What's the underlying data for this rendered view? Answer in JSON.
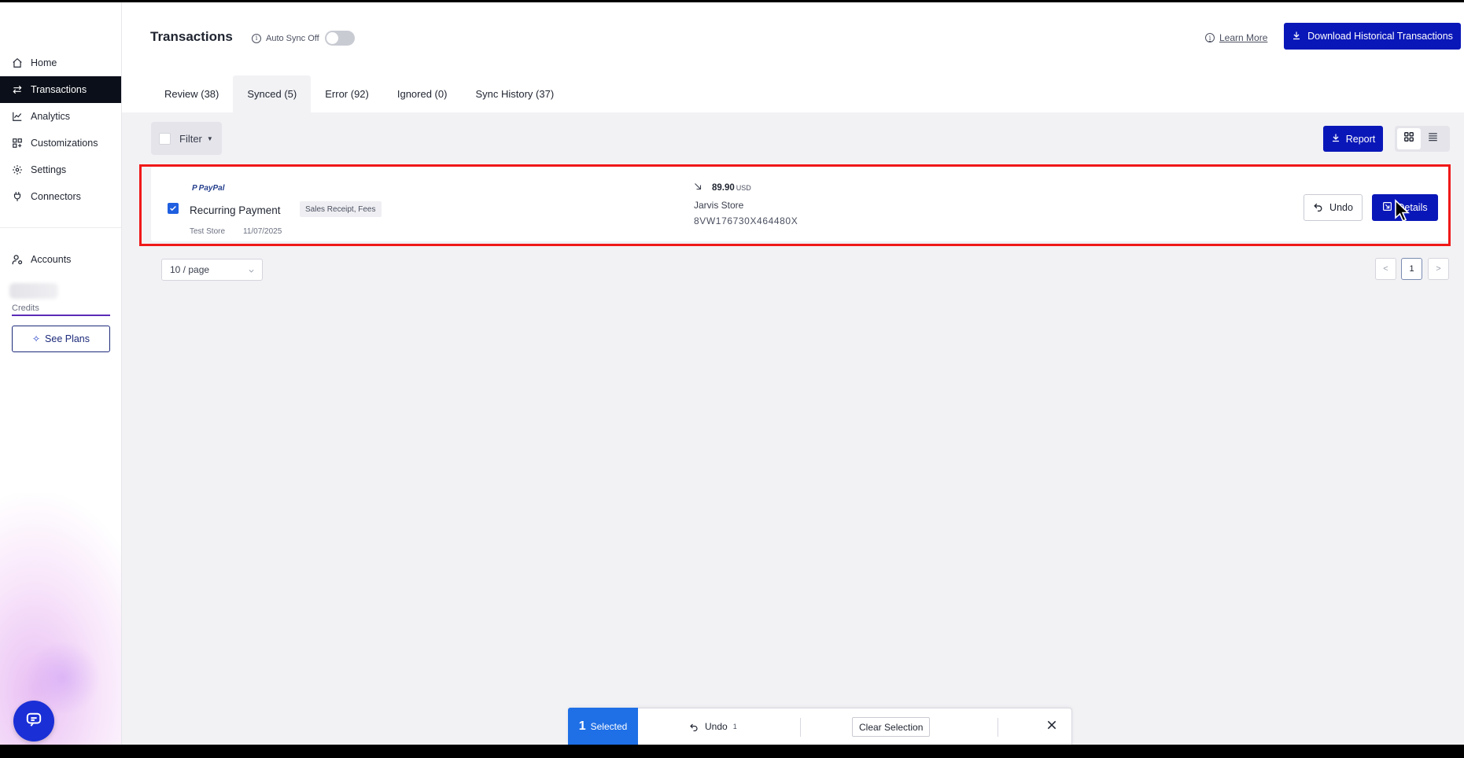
{
  "app": {
    "title": "Transactions",
    "auto_sync_label": "Auto Sync Off",
    "learn_more": "Learn More",
    "download_historical": "Download Historical Transactions"
  },
  "sidebar": {
    "items": [
      {
        "label": "Home",
        "icon": "home-icon"
      },
      {
        "label": "Transactions",
        "icon": "swap-arrows-icon",
        "active": true
      },
      {
        "label": "Analytics",
        "icon": "line-chart-icon"
      },
      {
        "label": "Customizations",
        "icon": "grid-plus-icon"
      },
      {
        "label": "Settings",
        "icon": "gear-icon"
      },
      {
        "label": "Connectors",
        "icon": "plug-icon"
      }
    ],
    "accounts_label": "Accounts",
    "credits_label": "Credits",
    "see_plans": "See Plans"
  },
  "tabs": [
    {
      "label": "Review (38)"
    },
    {
      "label": "Synced (5)",
      "active": true
    },
    {
      "label": "Error (92)"
    },
    {
      "label": "Ignored (0)"
    },
    {
      "label": "Sync History (37)"
    }
  ],
  "toolbar": {
    "filter_label": "Filter",
    "report_label": "Report",
    "view_modes": [
      "grid",
      "list"
    ],
    "active_view": "grid"
  },
  "transaction": {
    "source": "PayPal",
    "title": "Recurring Payment",
    "tag": "Sales Receipt, Fees",
    "store": "Test Store",
    "date": "11/07/2025",
    "amount": "89.90",
    "currency": "USD",
    "merchant": "Jarvis Store",
    "transaction_id": "8VW176730X464480X",
    "undo_label": "Undo",
    "details_label": "Details",
    "selected": true
  },
  "pagination": {
    "page_size": "10 / page",
    "current_page": "1",
    "prev": "<",
    "next": ">"
  },
  "selection_bar": {
    "count": "1",
    "selected_label": "Selected",
    "undo_label": "Undo",
    "undo_count": "1",
    "clear_label": "Clear Selection"
  },
  "colors": {
    "primary": "#0a17b8",
    "selection": "#1f6fe6",
    "highlight": "#f01818",
    "nav_active": "#0b0f19"
  }
}
